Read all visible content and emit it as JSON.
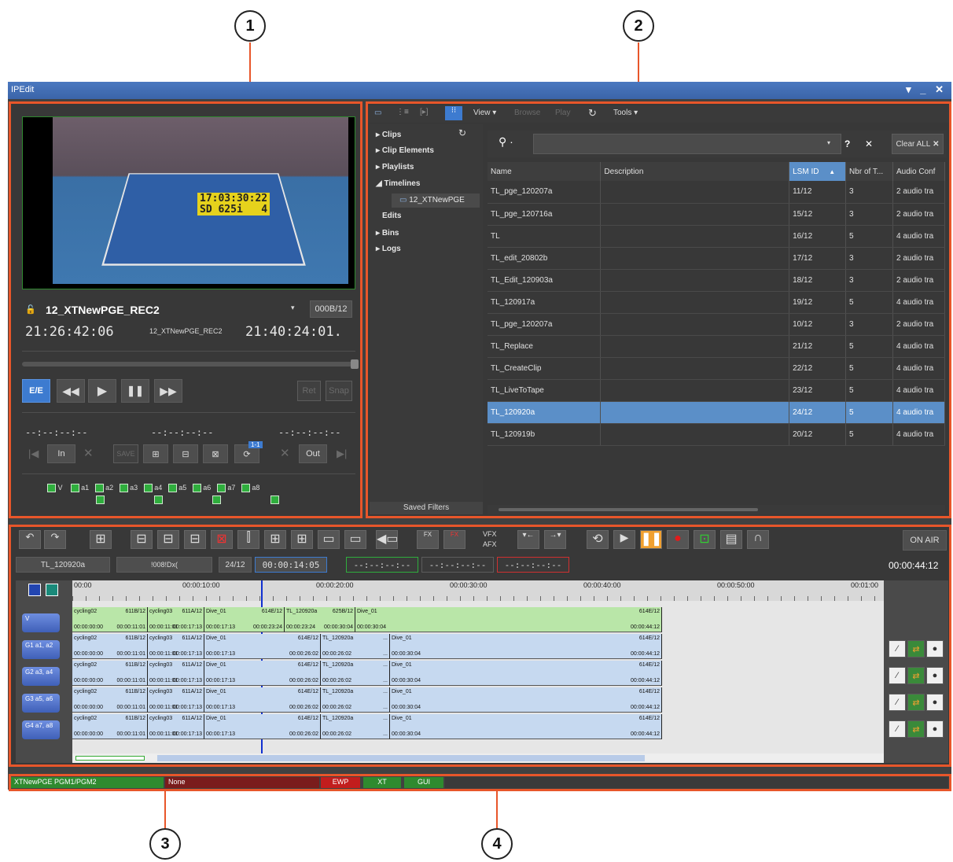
{
  "callouts": [
    "1",
    "2",
    "3",
    "4"
  ],
  "window": {
    "title": "IPEdit",
    "controls": "▾ _ ✕"
  },
  "player": {
    "clip_name": "12_XTNewPGE_REC2",
    "clip_id": "000B/12",
    "tc_in": "21:26:42:06",
    "tc_label": "12_XTNewPGE_REC2",
    "tc_out": "21:40:24:01.",
    "overlay_tc": "17:03:30:22",
    "overlay_fmt": "SD 625i",
    "overlay_num": "4",
    "ee_label": "E/E",
    "ret_label": "Ret",
    "snap_label": "Snap",
    "tc_blank": "--:--:--:--",
    "in_label": "In",
    "save_label": "SAVE",
    "out_label": "Out",
    "counter_badge": "1-1",
    "audio_checks": [
      "V",
      "a1",
      "a2",
      "a3",
      "a4",
      "a5",
      "a6",
      "a7",
      "a8"
    ]
  },
  "browser": {
    "toolbar": {
      "view": "View ▾",
      "browse": "Browse",
      "play": "Play",
      "tools": "Tools ▾"
    },
    "tree": [
      "Clips",
      "Clip Elements",
      "Playlists",
      "Timelines",
      "12_XTNewPGE",
      "Edits",
      "Bins",
      "Logs"
    ],
    "saved_filters": "Saved Filters",
    "search_help": "?",
    "search_clear": "✕",
    "clear_all": "Clear ALL",
    "columns": [
      "Name",
      "Description",
      "LSM ID",
      "Nbr of T...",
      "Audio Conf"
    ],
    "rows": [
      [
        "TL_pge_120207a",
        "",
        "11/12",
        "3",
        "2 audio tra"
      ],
      [
        "TL_pge_120716a",
        "",
        "15/12",
        "3",
        "2 audio tra"
      ],
      [
        "TL",
        "",
        "16/12",
        "5",
        "4 audio tra"
      ],
      [
        "TL_edit_20802b",
        "",
        "17/12",
        "3",
        "2 audio tra"
      ],
      [
        "TL_Edit_120903a",
        "",
        "18/12",
        "3",
        "2 audio tra"
      ],
      [
        "TL_120917a",
        "",
        "19/12",
        "5",
        "4 audio tra"
      ],
      [
        "TL_pge_120207a",
        "",
        "10/12",
        "3",
        "2 audio tra"
      ],
      [
        "TL_Replace",
        "",
        "21/12",
        "5",
        "4 audio tra"
      ],
      [
        "TL_CreateClip",
        "",
        "22/12",
        "5",
        "4 audio tra"
      ],
      [
        "TL_LiveToTape",
        "",
        "23/12",
        "5",
        "4 audio tra"
      ],
      [
        "TL_120920a",
        "",
        "24/12",
        "5",
        "4 audio tra"
      ],
      [
        "TL_120919b",
        "",
        "20/12",
        "5",
        "4 audio tra"
      ]
    ],
    "selected_row": 10
  },
  "timeline": {
    "vfx": "VFX",
    "afx": "AFX",
    "on_air": "ON AIR",
    "name": "TL_120920a",
    "field2": "!008!Dx(",
    "lsm": "24/12",
    "tc": "00:00:14:05",
    "tc_blank": "--:--:--:--",
    "duration": "00:00:44:12",
    "ruler": [
      "00:00",
      "00:00:10:00",
      "00:00:20:00",
      "00:00:30:00",
      "00:00:40:00",
      "00:00:50:00",
      "00:01:00"
    ],
    "tracks": [
      "V",
      "G1 a1, a2",
      "G2 a3, a4",
      "G3 a5, a6",
      "G4 a7, a8"
    ],
    "clips": [
      {
        "name": "cycling02",
        "id": "611B/12",
        "start": "00:00:00:00",
        "end": "00:00:11:01"
      },
      {
        "name": "cycling03",
        "id": "611A/12",
        "start": "00:00:11:01",
        "end": "00:00:17:13"
      },
      {
        "name": "Dive_01",
        "id": "614E/12",
        "start": "00:00:17:13",
        "end": "00:00:23:24"
      },
      {
        "name": "TL_120920a",
        "id": "625B/12",
        "start": "00:00:23:24",
        "end": "00:00:30:04"
      },
      {
        "name": "Dive_01",
        "id": "614E/12",
        "start": "00:00:30:04",
        "end": "00:00:44:12"
      }
    ],
    "audio_clips": [
      {
        "name": "cycling02",
        "id": "611B/12",
        "start": "00:00:00:00",
        "end": "00:00:11:01"
      },
      {
        "name": "cycling03",
        "id": "611A/12",
        "start": "00:00:11:01",
        "end": "00:00:17:13"
      },
      {
        "name": "Dive_01",
        "id": "614E/12",
        "start": "00:00:17:13",
        "end": "00:00:26:02"
      },
      {
        "name": "TL_120920a",
        "id": "...",
        "start": "00:00:26:02",
        "end": "..."
      },
      {
        "name": "Dive_01",
        "id": "614E/12",
        "start": "00:00:30:04",
        "end": "00:00:44:12"
      }
    ]
  },
  "status": {
    "server": "XTNewPGE PGM1/PGM2",
    "none": "None",
    "ewp": "EWP",
    "xt": "XT",
    "gui": "GUI"
  },
  "colors": {
    "accent": "#3d7bd0",
    "callout_frame": "#e8562a",
    "clip_video": "#b9e6a8",
    "clip_audio": "#c6d9f0",
    "playhead": "#1030d0",
    "record": "#e21b1b",
    "pause": "#f0a030"
  }
}
